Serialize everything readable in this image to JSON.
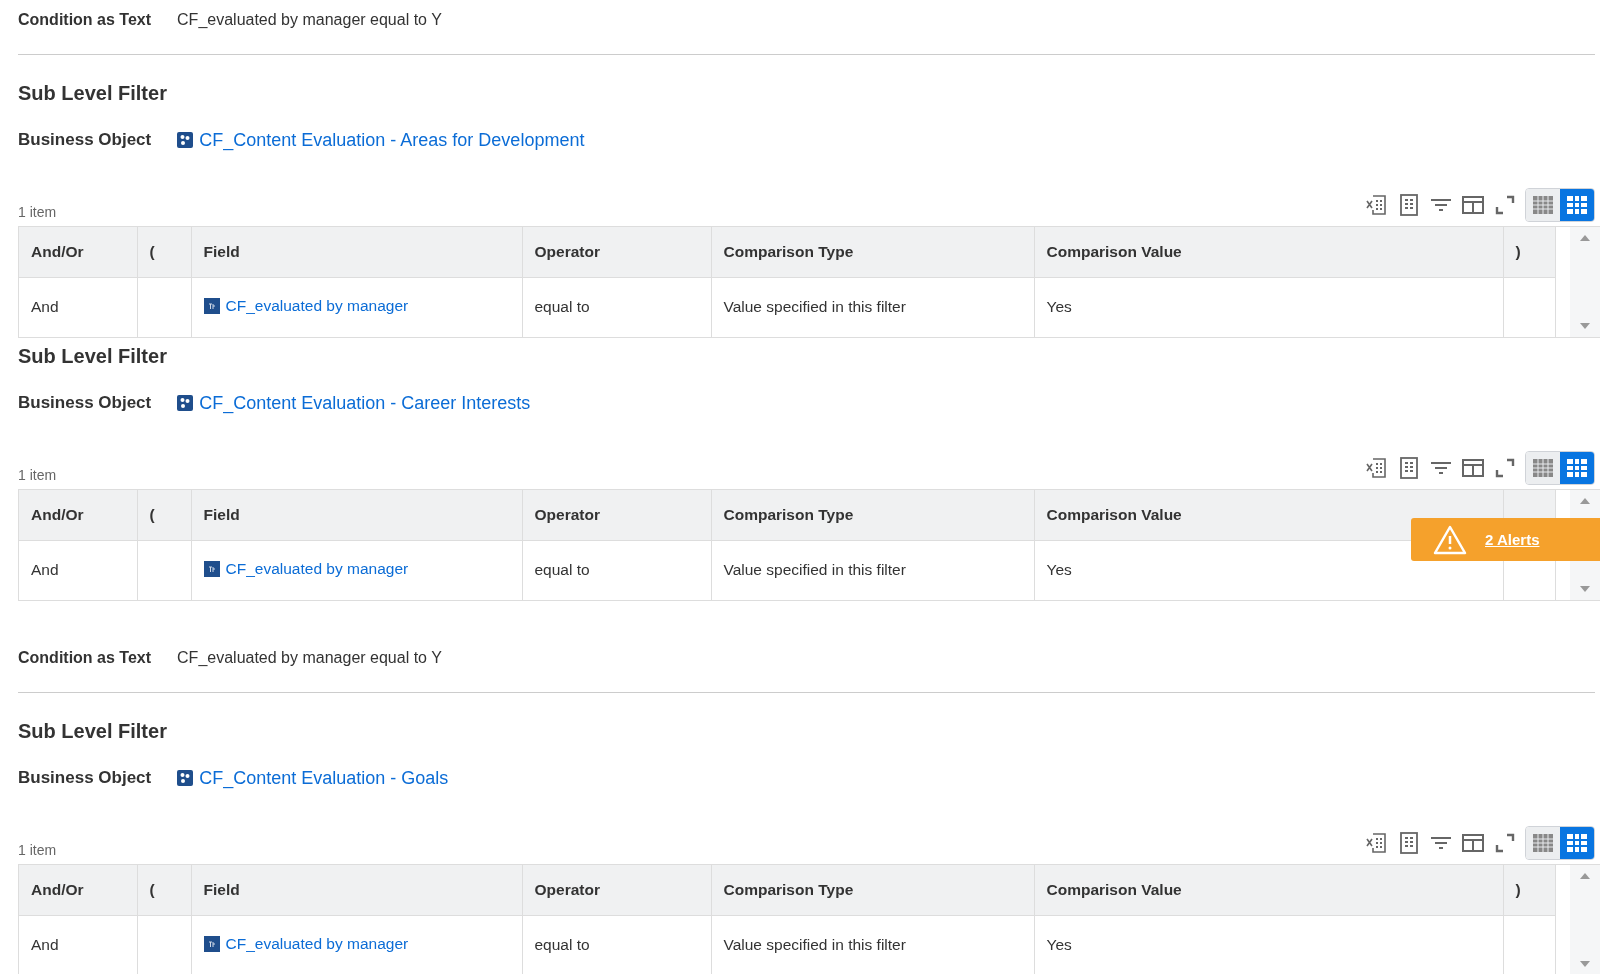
{
  "blocks": [
    {
      "kind": "condition",
      "label": "Condition as Text",
      "value": "CF_evaluated by manager equal to Y"
    },
    {
      "kind": "filter",
      "heading": "Sub Level Filter",
      "object_label": "Business Object",
      "object": "CF_Content Evaluation - Areas for Development",
      "count": "1 item",
      "views": [
        {
          "selected": false
        },
        {
          "selected": true
        }
      ],
      "columns": [
        "And/Or",
        "(",
        "Field",
        "Operator",
        "Comparison Type",
        "Comparison Value",
        ")"
      ],
      "rows": [
        [
          "And",
          "",
          "CF_evaluated by manager",
          "equal to",
          "Value specified in this filter",
          "Yes",
          ""
        ]
      ]
    },
    {
      "kind": "filter",
      "heading": "Sub Level Filter",
      "object_label": "Business Object",
      "object": "CF_Content Evaluation - Career Interests",
      "count": "1 item",
      "views": [
        {
          "selected": false
        },
        {
          "selected": true
        }
      ],
      "columns": [
        "And/Or",
        "(",
        "Field",
        "Operator",
        "Comparison Type",
        "Comparison Value"
      ],
      "rows": [
        [
          "And",
          "",
          "CF_evaluated by manager",
          "equal to",
          "Value specified in this filter",
          "Yes",
          ""
        ]
      ],
      "alert": "2 Alerts"
    },
    {
      "kind": "condition",
      "label": "Condition as Text",
      "value": "CF_evaluated by manager equal to Y"
    },
    {
      "kind": "filter",
      "heading": "Sub Level Filter",
      "object_label": "Business Object",
      "object": "CF_Content Evaluation - Goals",
      "count": "1 item",
      "views": [
        {
          "selected": false
        },
        {
          "selected": true
        }
      ],
      "columns": [
        "And/Or",
        "(",
        "Field",
        "Operator",
        "Comparison Type",
        "Comparison Value",
        ")"
      ],
      "rows": [
        [
          "And",
          "",
          "CF_evaluated by manager",
          "equal to",
          "Value specified in this filter",
          "Yes",
          ""
        ]
      ]
    }
  ]
}
